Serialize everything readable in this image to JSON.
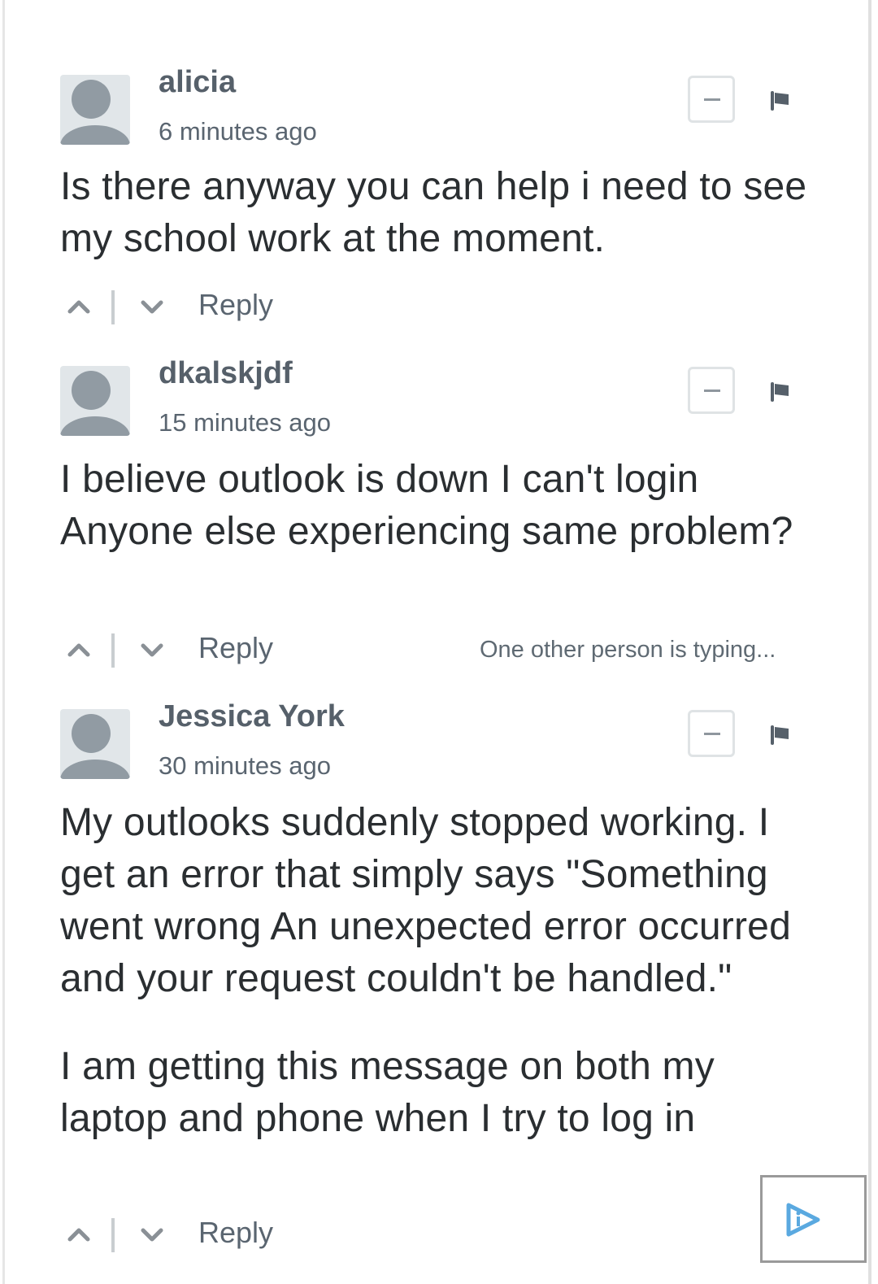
{
  "comments": [
    {
      "author": "alicia",
      "time": "6 minutes ago",
      "paragraphs": [
        "Is there anyway you can help i need to see my school work at the moment."
      ],
      "reply_label": "Reply",
      "typing_indicator": null
    },
    {
      "author": "dkalskjdf",
      "time": "15 minutes ago",
      "paragraphs": [
        "I believe outlook is down I can't login Anyone else experiencing same problem?"
      ],
      "reply_label": "Reply",
      "typing_indicator": "One other person is typing..."
    },
    {
      "author": "Jessica York",
      "time": "30 minutes ago",
      "paragraphs": [
        "My outlooks suddenly stopped working. I get an error that simply says \"Something went wrong An unexpected error occurred and your request couldn't be handled.\"",
        "I am getting this message on both my laptop and phone when I try to log in"
      ],
      "reply_label": "Reply",
      "typing_indicator": null
    }
  ],
  "icons": {
    "collapse": "minus-square-icon",
    "flag": "flag-icon",
    "upvote": "chevron-up-icon",
    "downvote": "chevron-down-icon",
    "ad": "adchoices-icon"
  },
  "colors": {
    "author": "#56606a",
    "meta": "#5a6570",
    "body": "#2a2e31",
    "avatar_bg": "#e1e6e9",
    "avatar_fg": "#919ba3",
    "ad_icon": "#5aa9e0"
  }
}
